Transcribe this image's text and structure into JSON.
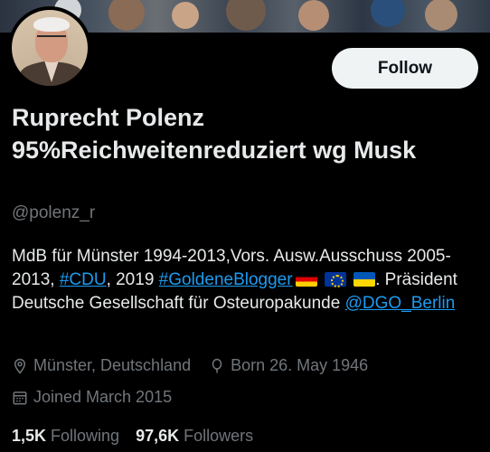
{
  "profile": {
    "name": "Ruprecht Polenz 95%Reichweitenreduziert wg Musk",
    "handle": "@polenz_r",
    "follow_label": "Follow",
    "bio": {
      "part1": "MdB für Münster 1994-2013,Vors. Ausw.Ausschuss 2005-2013, ",
      "hashtag_cdu": "#CDU",
      "part2": ", 2019 ",
      "hashtag_blogger": "#GoldeneBlogger",
      "part3": ". Präsident Deutsche Gesellschaft für Osteuropakunde ",
      "mention": "@DGO_Berlin"
    },
    "location": "Münster, Deutschland",
    "born": "Born 26. May 1946",
    "joined": "Joined March 2015",
    "following_count": "1,5K",
    "following_label": "Following",
    "followers_count": "97,6K",
    "followers_label": "Followers"
  },
  "colors": {
    "background": "#000000",
    "text": "#e7e9ea",
    "secondary": "#71767b",
    "link": "#1d9bf0",
    "button": "#eff3f4"
  },
  "icons": {
    "location": "location-pin-icon",
    "born": "balloon-icon",
    "joined": "calendar-icon"
  }
}
